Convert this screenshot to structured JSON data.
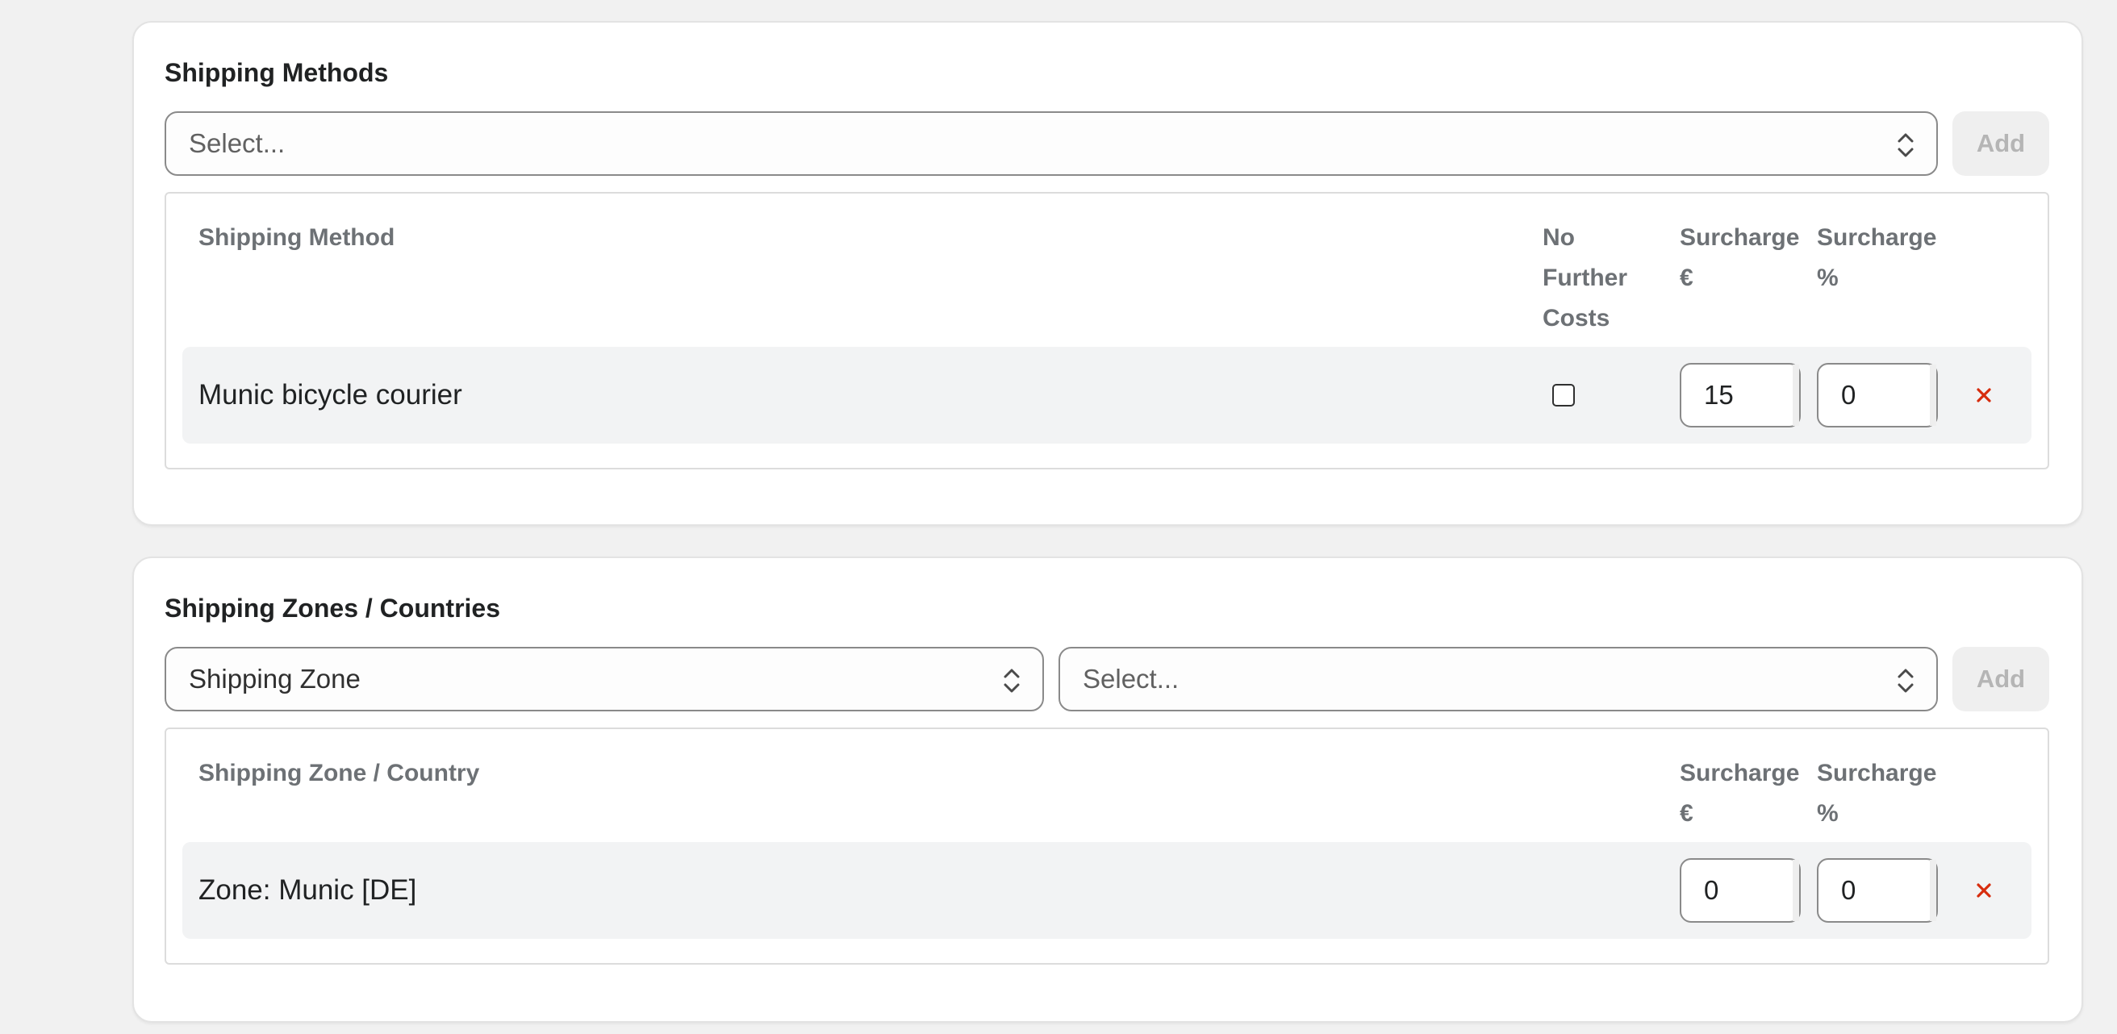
{
  "shipping_methods": {
    "title": "Shipping Methods",
    "select_placeholder": "Select...",
    "add_label": "Add",
    "columns": {
      "method": "Shipping Method",
      "no_further_costs": [
        "No",
        "Further",
        "Costs"
      ],
      "surcharge_eur": [
        "Surcharge",
        "€"
      ],
      "surcharge_pct": [
        "Surcharge",
        "%"
      ]
    },
    "rows": [
      {
        "name": "Munic bicycle courier",
        "no_further_costs": false,
        "surcharge_eur": "15",
        "surcharge_pct": "0"
      }
    ]
  },
  "shipping_zones": {
    "title": "Shipping Zones / Countries",
    "type_select_value": "Shipping Zone",
    "select_placeholder": "Select...",
    "add_label": "Add",
    "columns": {
      "zone": "Shipping Zone / Country",
      "surcharge_eur": [
        "Surcharge",
        "€"
      ],
      "surcharge_pct": [
        "Surcharge",
        "%"
      ]
    },
    "rows": [
      {
        "name": "Zone: Munic [DE]",
        "surcharge_eur": "0",
        "surcharge_pct": "0"
      }
    ]
  },
  "icons": {
    "select_chevron": "chevron-up-down-icon",
    "remove": "close-icon"
  },
  "colors": {
    "remove_icon": "#d72c0d",
    "header_text": "#6d7175",
    "row_background": "#f2f3f4"
  }
}
